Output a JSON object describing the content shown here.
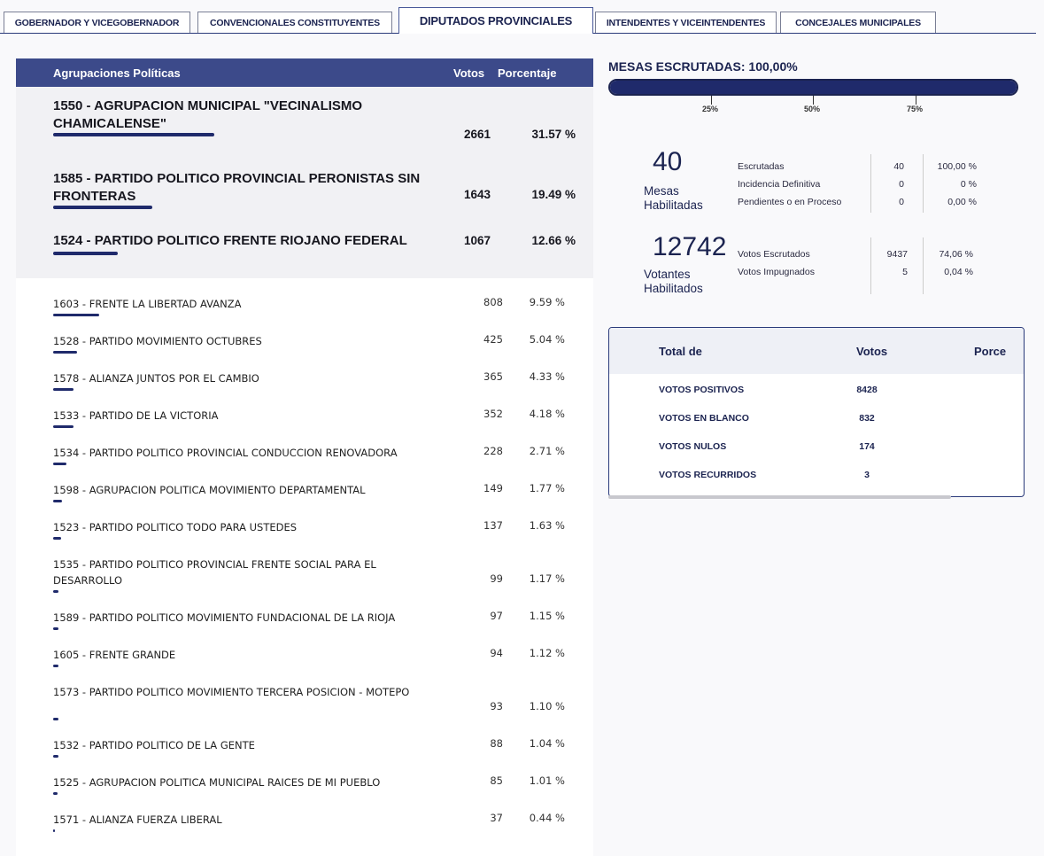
{
  "tabs": [
    {
      "label": "GOBERNADOR Y VICEGOBERNADOR",
      "active": false
    },
    {
      "label": "CONVENCIONALES CONSTITUYENTES",
      "active": false
    },
    {
      "label": "DIPUTADOS PROVINCIALES",
      "active": true
    },
    {
      "label": "INTENDENTES Y VICEINTENDENTES",
      "active": false
    },
    {
      "label": "CONCEJALES MUNICIPALES",
      "active": false
    }
  ],
  "results": {
    "headers": {
      "group": "Agrupaciones Políticas",
      "votes": "Votos",
      "percent": "Porcentaje"
    },
    "top": [
      {
        "name": "1550 - AGRUPACION MUNICIPAL \"VECINALISMO CHAMICALENSE\"",
        "votes": "2661",
        "percent": "31.57 %",
        "share": 31.57
      },
      {
        "name": "1585 - PARTIDO POLITICO PROVINCIAL PERONISTAS SIN FRONTERAS",
        "votes": "1643",
        "percent": "19.49 %",
        "share": 19.49
      },
      {
        "name": "1524 - PARTIDO POLITICO FRENTE RIOJANO FEDERAL",
        "votes": "1067",
        "percent": "12.66 %",
        "share": 12.66
      }
    ],
    "rows": [
      {
        "name": "1603 - FRENTE LA LIBERTAD AVANZA",
        "votes": "808",
        "percent": "9.59 %",
        "share": 9.59
      },
      {
        "name": "1528 - PARTIDO MOVIMIENTO OCTUBRES",
        "votes": "425",
        "percent": "5.04 %",
        "share": 5.04
      },
      {
        "name": "1578 - ALIANZA JUNTOS POR EL CAMBIO",
        "votes": "365",
        "percent": "4.33 %",
        "share": 4.33
      },
      {
        "name": "1533 - PARTIDO DE LA VICTORIA",
        "votes": "352",
        "percent": "4.18 %",
        "share": 4.18
      },
      {
        "name": "1534 - PARTIDO POLITICO PROVINCIAL CONDUCCION RENOVADORA",
        "votes": "228",
        "percent": "2.71 %",
        "share": 2.71
      },
      {
        "name": "1598 - AGRUPACION POLITICA MOVIMIENTO DEPARTAMENTAL",
        "votes": "149",
        "percent": "1.77 %",
        "share": 1.77
      },
      {
        "name": "1523 - PARTIDO POLITICO TODO PARA USTEDES",
        "votes": "137",
        "percent": "1.63 %",
        "share": 1.63
      },
      {
        "name": "1535 - PARTIDO POLITICO PROVINCIAL FRENTE SOCIAL PARA EL DESARROLLO",
        "votes": "99",
        "percent": "1.17 %",
        "share": 1.17
      },
      {
        "name": "1589 - PARTIDO POLITICO MOVIMIENTO FUNDACIONAL DE LA RIOJA",
        "votes": "97",
        "percent": "1.15 %",
        "share": 1.15
      },
      {
        "name": "1605 - FRENTE GRANDE",
        "votes": "94",
        "percent": "1.12 %",
        "share": 1.12
      },
      {
        "name": "1573 - PARTIDO POLITICO MOVIMIENTO TERCERA POSICION - MOTEPO",
        "votes": "93",
        "percent": "1.10 %",
        "share": 1.1
      },
      {
        "name": "1532 - PARTIDO POLITICO DE LA GENTE",
        "votes": "88",
        "percent": "1.04 %",
        "share": 1.04
      },
      {
        "name": "1525 - AGRUPACION POLITICA MUNICIPAL RAICES DE MI PUEBLO",
        "votes": "85",
        "percent": "1.01 %",
        "share": 1.01
      },
      {
        "name": "1571 - ALIANZA FUERZA LIBERAL",
        "votes": "37",
        "percent": "0.44 %",
        "share": 0.44
      }
    ]
  },
  "mesas": {
    "title": "MESAS ESCRUTADAS: 100,00%",
    "progress": 100,
    "ticks": [
      "25%",
      "50%",
      "75%"
    ]
  },
  "stats": {
    "mesas_count": "40",
    "mesas_label1": "Mesas",
    "mesas_label2": "Habilitadas",
    "mesas_rows": [
      {
        "label": "Escrutadas",
        "value": "40",
        "percent": "100,00 %"
      },
      {
        "label": "Incidencia Definitiva",
        "value": "0",
        "percent": "0 %"
      },
      {
        "label": "Pendientes o en Proceso",
        "value": "0",
        "percent": "0,00 %"
      }
    ],
    "votantes_count": "12742",
    "votantes_label1": "Votantes",
    "votantes_label2": "Habilitados",
    "votantes_rows": [
      {
        "label": "Votos Escrutados",
        "value": "9437",
        "percent": "74,06 %"
      },
      {
        "label": "Votos Impugnados",
        "value": "5",
        "percent": "0,04 %"
      }
    ]
  },
  "summary": {
    "headers": {
      "total": "Total de",
      "votes": "Votos",
      "percent": "Porce"
    },
    "rows": [
      {
        "label": "VOTOS POSITIVOS",
        "votes": "8428"
      },
      {
        "label": "VOTOS EN BLANCO",
        "votes": "832"
      },
      {
        "label": "VOTOS NULOS",
        "votes": "174"
      },
      {
        "label": "VOTOS RECURRIDOS",
        "votes": "3"
      }
    ]
  },
  "colors": {
    "primary": "#1f2a6b",
    "header": "#3c4a8a"
  }
}
